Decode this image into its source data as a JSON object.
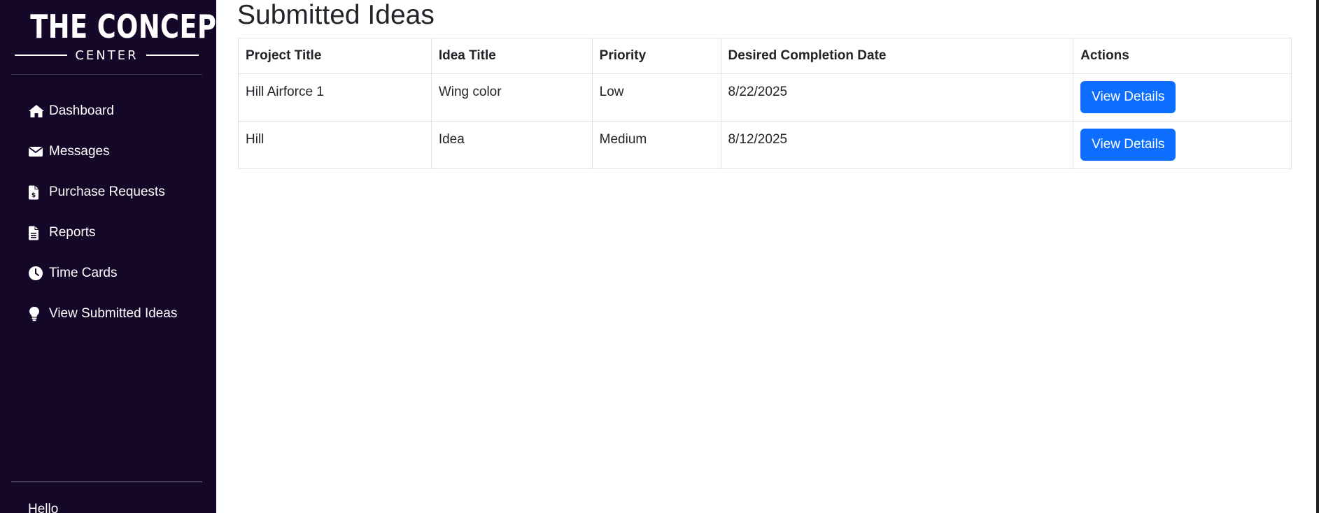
{
  "brand": {
    "main": "THE CONCEPT",
    "sub": "CENTER"
  },
  "sidebar": {
    "items": [
      {
        "label": "Dashboard",
        "icon": "home-icon"
      },
      {
        "label": "Messages",
        "icon": "envelope-icon"
      },
      {
        "label": "Purchase Requests",
        "icon": "invoice-dollar-icon"
      },
      {
        "label": "Reports",
        "icon": "file-text-icon"
      },
      {
        "label": "Time Cards",
        "icon": "clock-icon"
      },
      {
        "label": "View Submitted Ideas",
        "icon": "lightbulb-icon"
      }
    ],
    "greeting": "Hello"
  },
  "main": {
    "title": "Submitted Ideas",
    "table": {
      "headers": [
        "Project Title",
        "Idea Title",
        "Priority",
        "Desired Completion Date",
        "Actions"
      ],
      "rows": [
        {
          "project": "Hill Airforce 1",
          "idea": "Wing color",
          "priority": "Low",
          "date": "8/22/2025",
          "action": "View Details"
        },
        {
          "project": "Hill",
          "idea": "Idea",
          "priority": "Medium",
          "date": "8/12/2025",
          "action": "View Details"
        }
      ]
    }
  },
  "colors": {
    "sidebar_bg": "#150728",
    "primary_button": "#0d6efd",
    "table_border": "#dee2e6"
  }
}
